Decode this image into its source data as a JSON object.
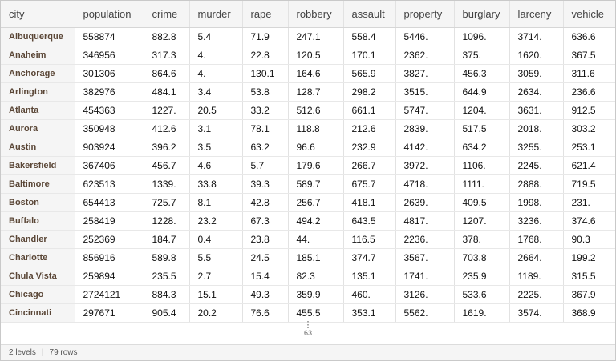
{
  "columns": [
    "city",
    "population",
    "crime",
    "murder",
    "rape",
    "robbery",
    "assault",
    "property",
    "burglary",
    "larceny",
    "vehicle"
  ],
  "rows": [
    [
      "Albuquerque",
      "558874",
      "882.8",
      "5.4",
      "71.9",
      "247.1",
      "558.4",
      "5446.",
      "1096.",
      "3714.",
      "636.6"
    ],
    [
      "Anaheim",
      "346956",
      "317.3",
      "4.",
      "22.8",
      "120.5",
      "170.1",
      "2362.",
      "375.",
      "1620.",
      "367.5"
    ],
    [
      "Anchorage",
      "301306",
      "864.6",
      "4.",
      "130.1",
      "164.6",
      "565.9",
      "3827.",
      "456.3",
      "3059.",
      "311.6"
    ],
    [
      "Arlington",
      "382976",
      "484.1",
      "3.4",
      "53.8",
      "128.7",
      "298.2",
      "3515.",
      "644.9",
      "2634.",
      "236.6"
    ],
    [
      "Atlanta",
      "454363",
      "1227.",
      "20.5",
      "33.2",
      "512.6",
      "661.1",
      "5747.",
      "1204.",
      "3631.",
      "912.5"
    ],
    [
      "Aurora",
      "350948",
      "412.6",
      "3.1",
      "78.1",
      "118.8",
      "212.6",
      "2839.",
      "517.5",
      "2018.",
      "303.2"
    ],
    [
      "Austin",
      "903924",
      "396.2",
      "3.5",
      "63.2",
      "96.6",
      "232.9",
      "4142.",
      "634.2",
      "3255.",
      "253.1"
    ],
    [
      "Bakersfield",
      "367406",
      "456.7",
      "4.6",
      "5.7",
      "179.6",
      "266.7",
      "3972.",
      "1106.",
      "2245.",
      "621.4"
    ],
    [
      "Baltimore",
      "623513",
      "1339.",
      "33.8",
      "39.3",
      "589.7",
      "675.7",
      "4718.",
      "1111.",
      "2888.",
      "719.5"
    ],
    [
      "Boston",
      "654413",
      "725.7",
      "8.1",
      "42.8",
      "256.7",
      "418.1",
      "2639.",
      "409.5",
      "1998.",
      "231."
    ],
    [
      "Buffalo",
      "258419",
      "1228.",
      "23.2",
      "67.3",
      "494.2",
      "643.5",
      "4817.",
      "1207.",
      "3236.",
      "374.6"
    ],
    [
      "Chandler",
      "252369",
      "184.7",
      "0.4",
      "23.8",
      "44.",
      "116.5",
      "2236.",
      "378.",
      "1768.",
      "90.3"
    ],
    [
      "Charlotte",
      "856916",
      "589.8",
      "5.5",
      "24.5",
      "185.1",
      "374.7",
      "3567.",
      "703.8",
      "2664.",
      "199.2"
    ],
    [
      "Chula Vista",
      "259894",
      "235.5",
      "2.7",
      "15.4",
      "82.3",
      "135.1",
      "1741.",
      "235.9",
      "1189.",
      "315.5"
    ],
    [
      "Chicago",
      "2724121",
      "884.3",
      "15.1",
      "49.3",
      "359.9",
      "460.",
      "3126.",
      "533.6",
      "2225.",
      "367.9"
    ],
    [
      "Cincinnati",
      "297671",
      "905.4",
      "20.2",
      "76.6",
      "455.5",
      "353.1",
      "5562.",
      "1619.",
      "3574.",
      "368.9"
    ]
  ],
  "more": {
    "dots": "⋮",
    "count": "63"
  },
  "footer": {
    "levels": "2 levels",
    "rows": "79 rows",
    "separator": "|"
  }
}
